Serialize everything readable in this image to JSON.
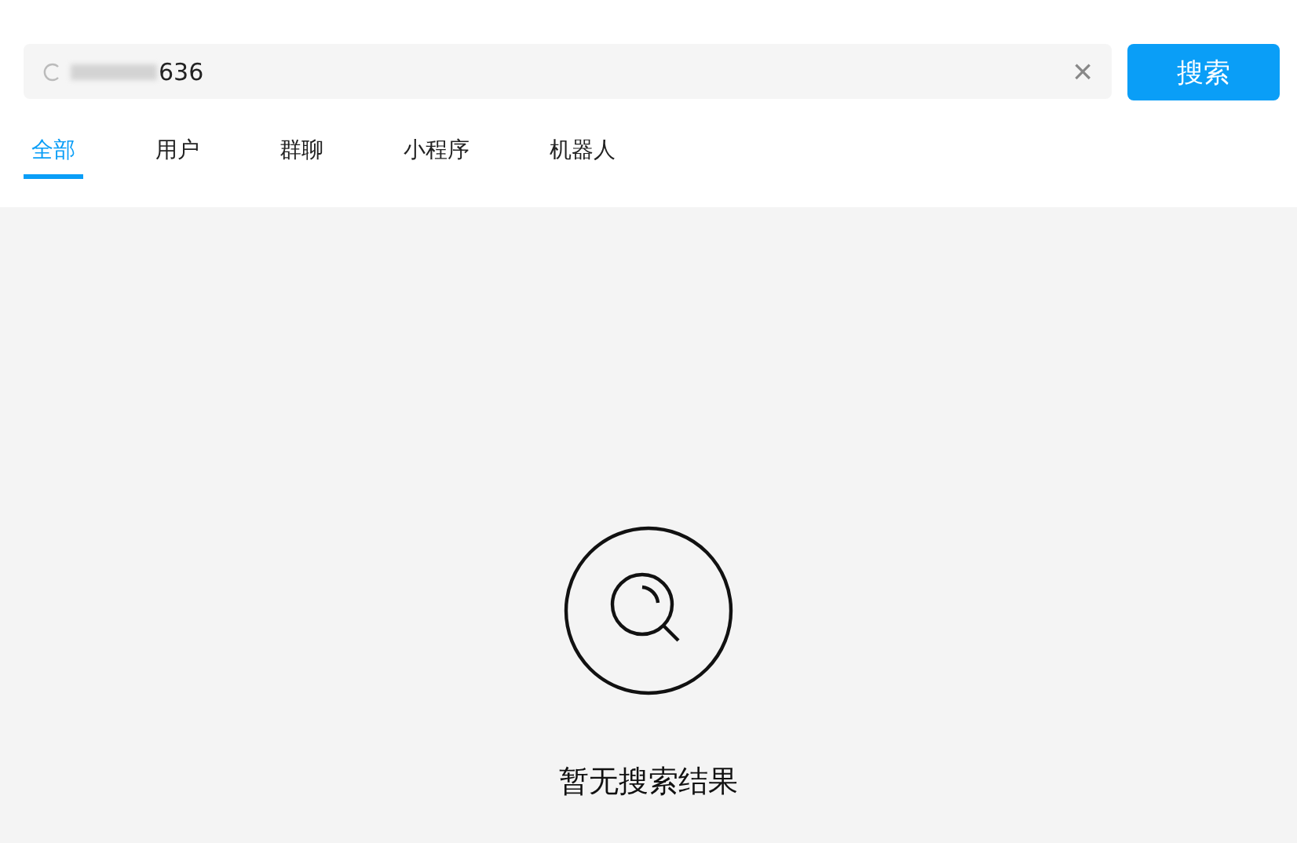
{
  "search": {
    "value": "636",
    "clear_label": "×",
    "button": "搜索"
  },
  "tabs": [
    {
      "label": "全部",
      "selected": true
    },
    {
      "label": "用户",
      "selected": false
    },
    {
      "label": "群聊",
      "selected": false
    },
    {
      "label": "小程序",
      "selected": false
    },
    {
      "label": "机器人",
      "selected": false
    }
  ],
  "empty_state": {
    "message": "暂无搜索结果"
  }
}
